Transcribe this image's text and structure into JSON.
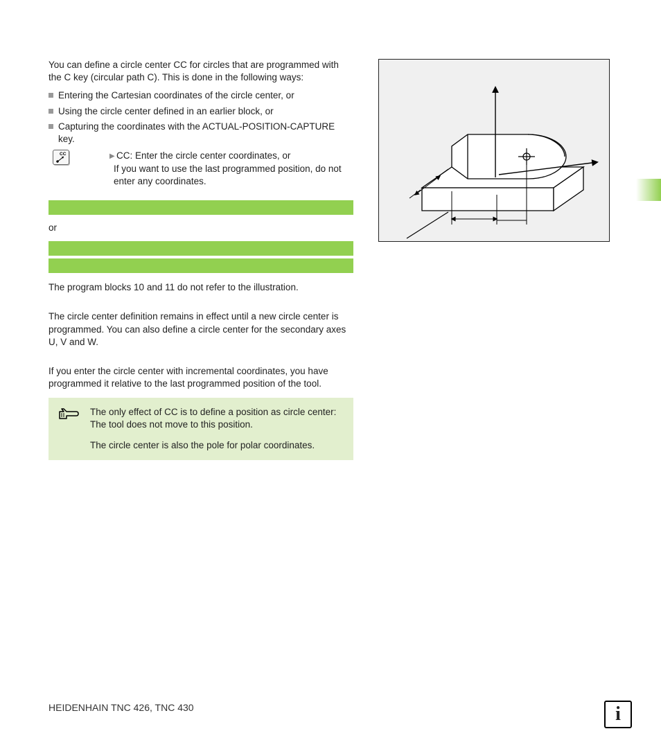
{
  "intro": "You can define a circle center CC for circles that are programmed with the C key (circular path C). This is done in the following ways:",
  "bullets": [
    "Entering the Cartesian coordinates of the circle center, or",
    "Using the circle center defined in an earlier block, or",
    "Capturing the coordinates with the ACTUAL-POSITION-CAPTURE key."
  ],
  "cc": {
    "label": "CC",
    "line1": "CC: Enter the circle center coordinates, or",
    "line2": "If you want to use the last programmed position, do not enter any coordinates."
  },
  "or_label": "or",
  "note": "The program blocks 10 and 11 do not refer to the illustration.",
  "para_duration": "The circle center definition remains in effect until a new circle center is programmed. You can also define a circle center for the secondary axes U, V and W.",
  "para_incremental": "If you enter the circle center with incremental coordinates, you have programmed it relative to the last programmed position of the tool.",
  "tip": {
    "p1": "The only effect of CC is to define a position as circle center: The tool does not move to this position.",
    "p2": "The circle center is also the pole for polar coordinates."
  },
  "footer": "HEIDENHAIN TNC 426, TNC 430",
  "info_glyph": "i"
}
